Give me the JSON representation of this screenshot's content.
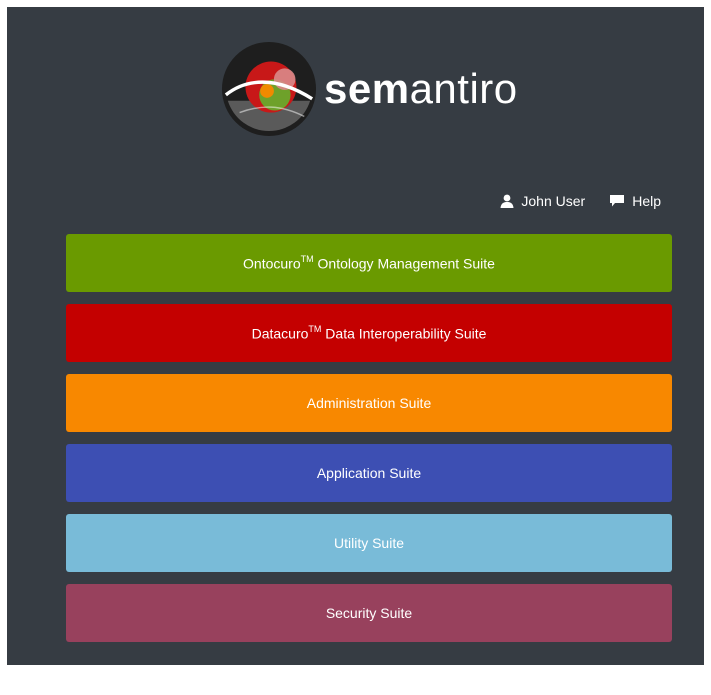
{
  "brand": {
    "bold": "sem",
    "light": "antiro"
  },
  "user": {
    "name": "John User",
    "icon": "user-icon"
  },
  "help": {
    "label": "Help",
    "icon": "speech-bubble-icon"
  },
  "suites": [
    {
      "name": "Ontocuro",
      "tm": "TM",
      "rest": " Ontology Management Suite",
      "color": "#6a9a00"
    },
    {
      "name": "Datacuro",
      "tm": "TM",
      "rest": " Data Interoperability Suite",
      "color": "#c40000"
    },
    {
      "name": "Administration Suite",
      "tm": "",
      "rest": "",
      "color": "#f88800"
    },
    {
      "name": "Application Suite",
      "tm": "",
      "rest": "",
      "color": "#3d4fb3"
    },
    {
      "name": "Utility Suite",
      "tm": "",
      "rest": "",
      "color": "#79bbd8"
    },
    {
      "name": "Security Suite",
      "tm": "",
      "rest": "",
      "color": "#98415d"
    }
  ],
  "colors": {
    "background": "#363c43",
    "text": "#ffffff"
  }
}
